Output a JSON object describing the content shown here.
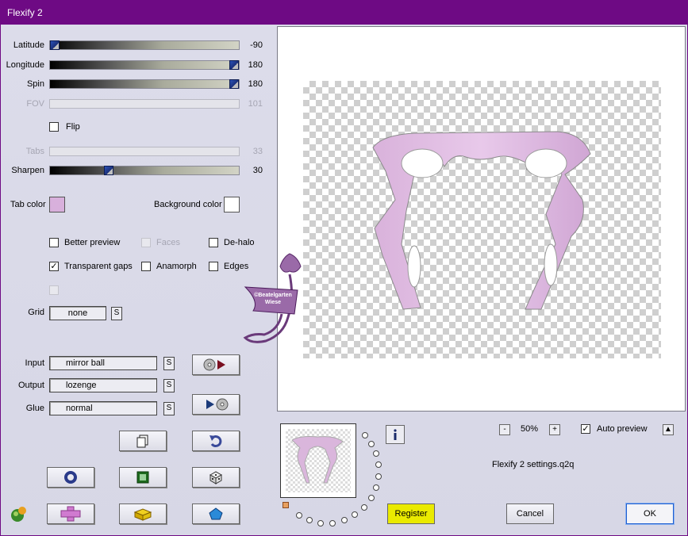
{
  "window": {
    "title": "Flexify 2"
  },
  "sliders": [
    {
      "label": "Latitude",
      "value": "-90",
      "level": 0.0,
      "enabled": true
    },
    {
      "label": "Longitude",
      "value": "180",
      "level": 1.0,
      "enabled": true
    },
    {
      "label": "Spin",
      "value": "180",
      "level": 1.0,
      "enabled": true
    },
    {
      "label": "FOV",
      "value": "101",
      "level": 0.0,
      "enabled": false
    },
    {
      "label": "Tabs",
      "value": "33",
      "level": 0.0,
      "enabled": false
    },
    {
      "label": "Sharpen",
      "value": "30",
      "level": 0.3,
      "enabled": true
    }
  ],
  "flip": {
    "label": "Flip",
    "checked": false
  },
  "colors": {
    "tab_color_label": "Tab color",
    "tab_color": "#d8b0dc",
    "background_color_label": "Background color",
    "background_color": "#ffffff",
    "accent_title": "#6e0a84",
    "register_bg": "#eaea00"
  },
  "checkboxes": {
    "better_preview": {
      "label": "Better preview",
      "checked": false
    },
    "faces": {
      "label": "Faces",
      "checked": false
    },
    "de_halo": {
      "label": "De-halo",
      "checked": false
    },
    "transparent_gaps": {
      "label": "Transparent gaps",
      "checked": true
    },
    "anamorph": {
      "label": "Anamorph",
      "checked": false
    },
    "edges": {
      "label": "Edges",
      "checked": false
    }
  },
  "grid": {
    "label": "Grid",
    "value": "none",
    "s_label": "S"
  },
  "projection": {
    "input_label": "Input",
    "input_value": "mirror ball",
    "output_label": "Output",
    "output_value": "lozenge",
    "glue_label": "Glue",
    "glue_value": "normal",
    "s_label": "S"
  },
  "watermark_text": "©Beatelgarten Wiese",
  "zoom": {
    "minus": "-",
    "value": "50%",
    "plus": "+"
  },
  "auto_preview": {
    "label": "Auto preview",
    "checked": true,
    "up_glyph": "▲"
  },
  "settings_file": "Flexify 2 settings.q2q",
  "buttons": {
    "register": "Register",
    "cancel": "Cancel",
    "ok": "OK"
  },
  "icons": {
    "input_play": "disc-to-play-icon",
    "output_play": "play-to-disc-icon",
    "copy": "copy-pages-icon",
    "undo": "undo-arrow-icon",
    "reset": "ring-icon",
    "frame": "green-square-icon",
    "random": "dice-icon",
    "plugin": "plugin-logo-icon",
    "cross": "pink-cross-icon",
    "block": "yellow-block-icon",
    "gem": "blue-pentagon-icon",
    "info": "info-icon",
    "preset_swatch": "orange-square-icon"
  }
}
